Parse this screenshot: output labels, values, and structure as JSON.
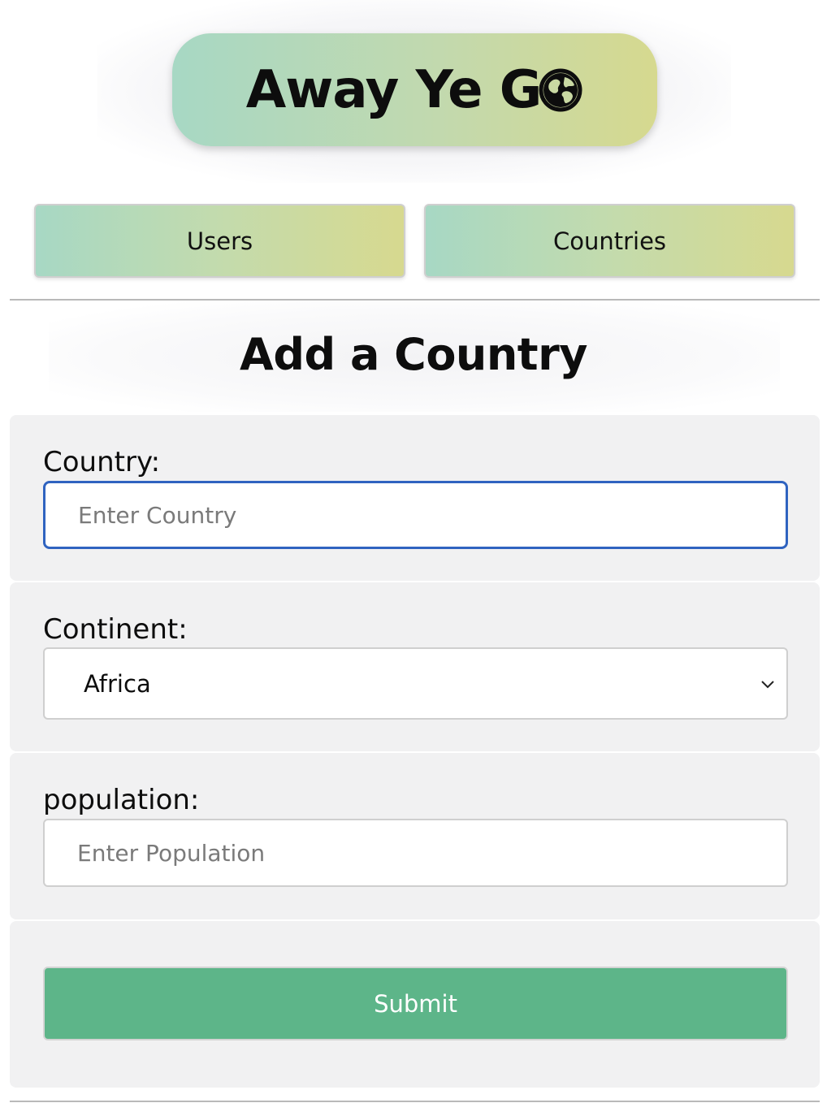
{
  "header": {
    "logo_text": "Away Ye G",
    "logo_icon": "globe-icon"
  },
  "nav": {
    "users_label": "Users",
    "countries_label": "Countries"
  },
  "main": {
    "title": "Add a Country"
  },
  "form": {
    "country_label": "Country:",
    "country_placeholder": "Enter Country",
    "country_value": "",
    "continent_label": "Continent:",
    "continent_selected": "Africa",
    "continent_icon": "chevron-down-icon",
    "population_label": "population:",
    "population_placeholder": "Enter Population",
    "population_value": "",
    "submit_label": "Submit"
  },
  "colors": {
    "gradient_start": "#a7d8c4",
    "gradient_end": "#d6d98f",
    "submit_green": "#5db589",
    "focus_blue": "#2f63c0",
    "panel_gray": "#f1f1f2"
  }
}
